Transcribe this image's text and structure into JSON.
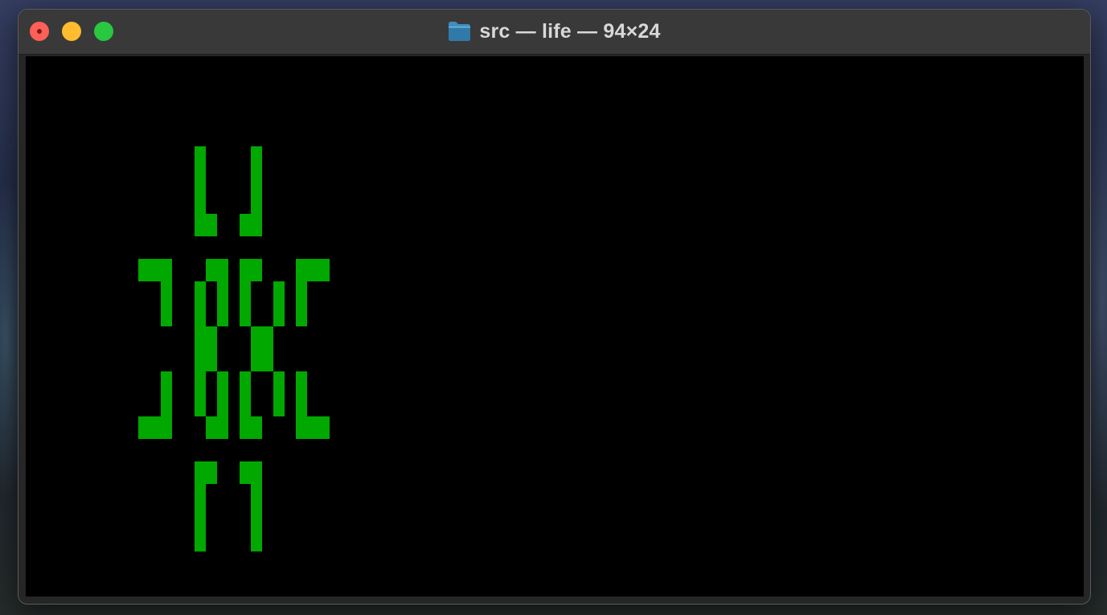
{
  "window": {
    "title": "src — life — 94×24",
    "title_icon": "folder-icon",
    "controls": {
      "close": "close-button",
      "minimize": "minimize-button",
      "zoom": "zoom-button"
    }
  },
  "terminal": {
    "columns": 94,
    "rows": 24,
    "background_color": "#000000",
    "cell_color": "#00a800",
    "live_cells": [
      [
        4,
        15
      ],
      [
        4,
        20
      ],
      [
        5,
        15
      ],
      [
        5,
        20
      ],
      [
        6,
        15
      ],
      [
        6,
        20
      ],
      [
        7,
        15
      ],
      [
        7,
        16
      ],
      [
        7,
        19
      ],
      [
        7,
        20
      ],
      [
        9,
        10
      ],
      [
        9,
        11
      ],
      [
        9,
        12
      ],
      [
        9,
        16
      ],
      [
        9,
        17
      ],
      [
        9,
        19
      ],
      [
        9,
        20
      ],
      [
        9,
        24
      ],
      [
        9,
        25
      ],
      [
        9,
        26
      ],
      [
        10,
        12
      ],
      [
        10,
        15
      ],
      [
        10,
        17
      ],
      [
        10,
        19
      ],
      [
        10,
        22
      ],
      [
        10,
        24
      ],
      [
        11,
        12
      ],
      [
        11,
        15
      ],
      [
        11,
        17
      ],
      [
        11,
        19
      ],
      [
        11,
        22
      ],
      [
        11,
        24
      ],
      [
        12,
        15
      ],
      [
        12,
        16
      ],
      [
        12,
        20
      ],
      [
        12,
        21
      ],
      [
        13,
        15
      ],
      [
        13,
        16
      ],
      [
        13,
        20
      ],
      [
        13,
        21
      ],
      [
        14,
        12
      ],
      [
        14,
        15
      ],
      [
        14,
        17
      ],
      [
        14,
        19
      ],
      [
        14,
        22
      ],
      [
        14,
        24
      ],
      [
        15,
        12
      ],
      [
        15,
        15
      ],
      [
        15,
        17
      ],
      [
        15,
        19
      ],
      [
        15,
        22
      ],
      [
        15,
        24
      ],
      [
        16,
        10
      ],
      [
        16,
        11
      ],
      [
        16,
        12
      ],
      [
        16,
        16
      ],
      [
        16,
        17
      ],
      [
        16,
        19
      ],
      [
        16,
        20
      ],
      [
        16,
        24
      ],
      [
        16,
        25
      ],
      [
        16,
        26
      ],
      [
        18,
        15
      ],
      [
        18,
        16
      ],
      [
        18,
        19
      ],
      [
        18,
        20
      ],
      [
        19,
        15
      ],
      [
        19,
        20
      ],
      [
        20,
        15
      ],
      [
        20,
        20
      ],
      [
        21,
        15
      ],
      [
        21,
        20
      ]
    ]
  }
}
